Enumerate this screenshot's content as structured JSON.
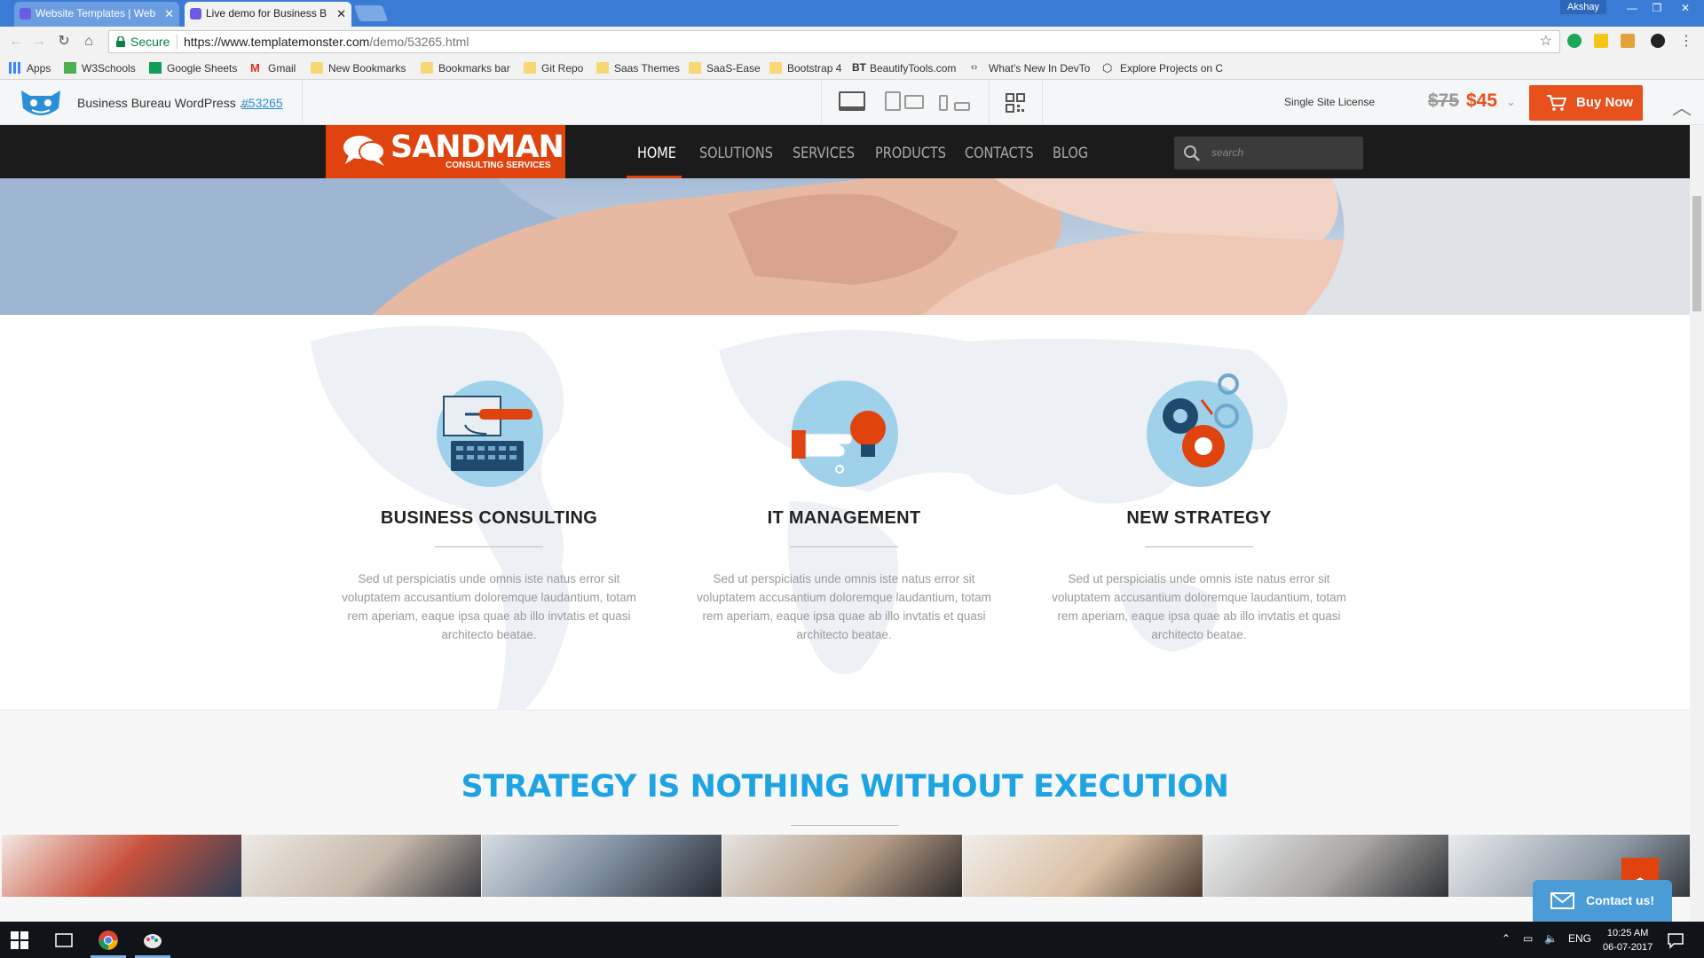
{
  "browser": {
    "tabs": [
      {
        "title": "Website Templates | Web"
      },
      {
        "title": "Live demo for Business B"
      }
    ],
    "user": "Akshay",
    "secure_label": "Secure",
    "url_host": "https://www.templatemonster.com",
    "url_path": "/demo/53265.html",
    "bookmarks": [
      "Apps",
      "W3Schools",
      "Google Sheets",
      "Gmail",
      "New Bookmarks",
      "Bookmarks bar",
      "Git Repo",
      "Saas Themes",
      "SaaS-Ease",
      "Bootstrap 4",
      "BeautifyTools.com",
      "What's New In DevTo",
      "Explore Projects on C"
    ]
  },
  "preview_bar": {
    "title": "Business Bureau WordPress ...",
    "template_id": "#53265",
    "license": "Single Site License",
    "old_price": "$75",
    "new_price": "$45",
    "buy_label": "Buy Now"
  },
  "site": {
    "brand": "SANDMAN",
    "brand_sub": "CONSULTING SERVICES",
    "menu": [
      "HOME",
      "SOLUTIONS",
      "SERVICES",
      "PRODUCTS",
      "CONTACTS",
      "BLOG"
    ],
    "active_menu": "HOME",
    "search_placeholder": "search",
    "services": [
      {
        "title": "BUSINESS CONSULTING",
        "text": "Sed ut perspiciatis unde omnis iste natus error sit voluptatem accusantium doloremque laudantium, totam rem aperiam, eaque ipsa quae ab illo invtatis et quasi architecto beatae."
      },
      {
        "title": "IT MANAGEMENT",
        "text": "Sed ut perspiciatis unde omnis iste natus error sit voluptatem accusantium doloremque laudantium, totam rem aperiam, eaque ipsa quae ab illo invtatis et quasi architecto beatae."
      },
      {
        "title": "NEW STRATEGY",
        "text": "Sed ut perspiciatis unde omnis iste natus error sit voluptatem accusantium doloremque laudantium, totam rem aperiam, eaque ipsa quae ab illo invtatis et quasi architecto beatae."
      }
    ],
    "strategy_title": "STRATEGY IS NOTHING WITHOUT EXECUTION",
    "contact_label": "Contact us!",
    "colors": {
      "brand": "#e0430e",
      "accent_blue": "#1ea3e3"
    }
  },
  "taskbar": {
    "language": "ENG",
    "time": "10:25 AM",
    "date": "06-07-2017"
  }
}
